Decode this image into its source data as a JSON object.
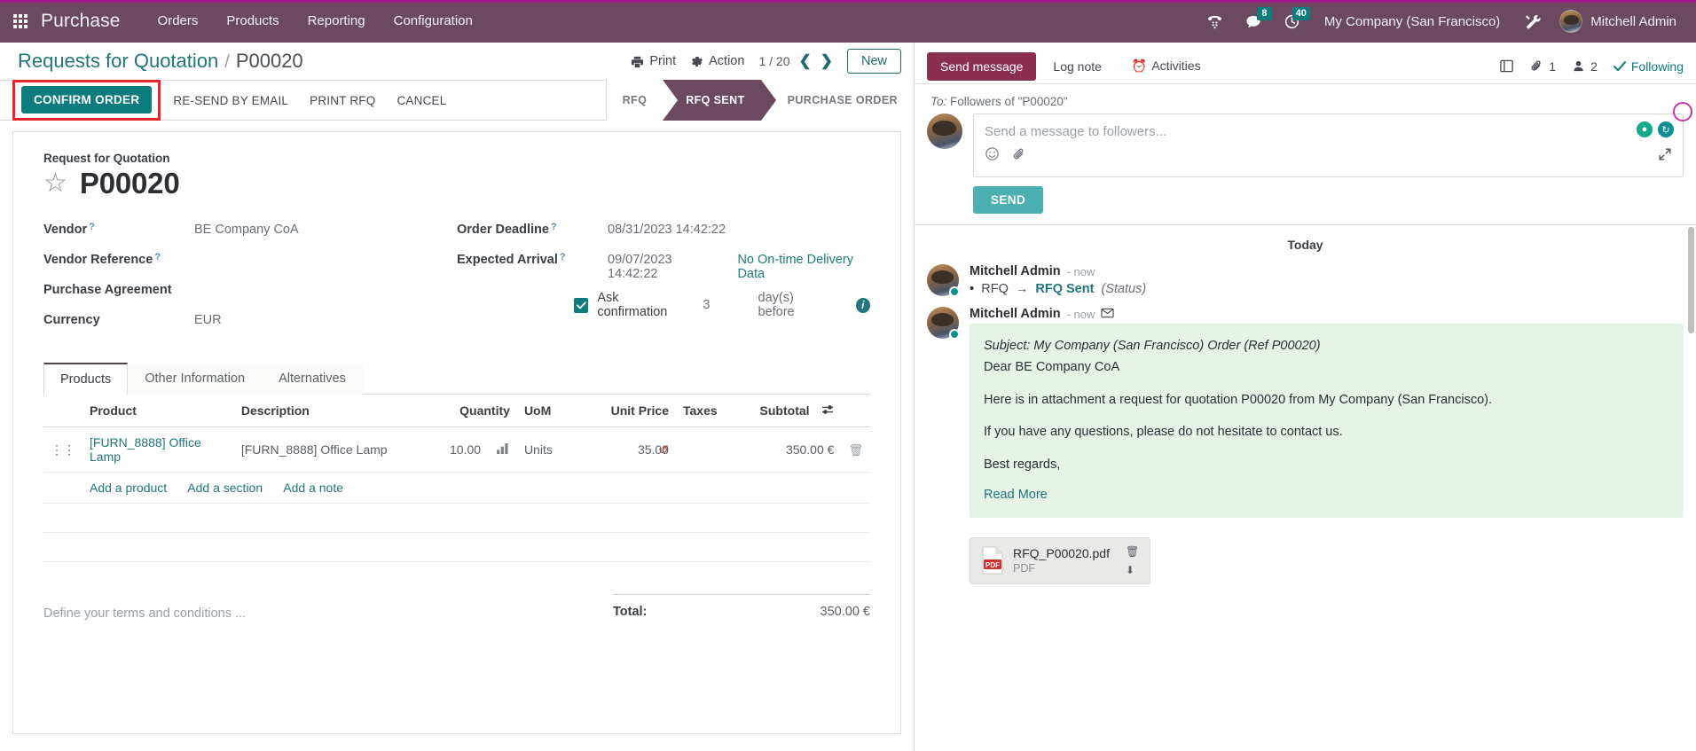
{
  "navbar": {
    "apps_icon": "apps-grid-icon",
    "brand": "Purchase",
    "menus": [
      "Orders",
      "Products",
      "Reporting",
      "Configuration"
    ],
    "icons": [
      {
        "name": "phone-keypad-icon",
        "badge": ""
      },
      {
        "name": "messages-icon",
        "badge": "8"
      },
      {
        "name": "activities-clock-icon",
        "badge": "40"
      }
    ],
    "company": "My Company (San Francisco)",
    "debug_icon": "tools-wrench-icon",
    "user": "Mitchell Admin",
    "accent": "#6b4a5f",
    "accent_top": "#a0198f",
    "badge_color": "#0d7c7c"
  },
  "control_panel": {
    "breadcrumb_root": "Requests for Quotation",
    "breadcrumb_sep": "/",
    "breadcrumb_current": "P00020",
    "print_label": "Print",
    "print_icon": "printer-icon",
    "action_label": "Action",
    "action_icon": "gear-icon",
    "pager": "1 / 20",
    "prev_icon": "chevron-left-icon",
    "next_icon": "chevron-right-icon",
    "new_label": "New"
  },
  "action_bar": {
    "confirm_label": "CONFIRM ORDER",
    "buttons": [
      "RE-SEND BY EMAIL",
      "PRINT RFQ",
      "CANCEL"
    ],
    "highlight_color": "#e8232a",
    "primary_color": "#0d7c7c",
    "statuses": [
      {
        "label": "RFQ",
        "active": false
      },
      {
        "label": "RFQ SENT",
        "active": true
      },
      {
        "label": "PURCHASE ORDER",
        "active": false
      }
    ]
  },
  "form": {
    "subtitle": "Request for Quotation",
    "star_icon": "star-outline-icon",
    "title": "P00020",
    "left_fields": [
      {
        "label": "Vendor",
        "help": true,
        "value": "BE Company CoA",
        "link": true
      },
      {
        "label": "Vendor Reference",
        "help": true,
        "value": ""
      },
      {
        "label": "Purchase Agreement",
        "help": false,
        "value": ""
      },
      {
        "label": "Currency",
        "help": false,
        "value": "EUR"
      }
    ],
    "right_fields": [
      {
        "label": "Order Deadline",
        "help": true,
        "value": "08/31/2023 14:42:22",
        "extra": ""
      },
      {
        "label": "Expected Arrival",
        "help": true,
        "value": "09/07/2023 14:42:22",
        "extra": "No On-time Delivery Data"
      }
    ],
    "ask_confirmation": {
      "checked": true,
      "label": "Ask confirmation",
      "days": "3",
      "suffix": "day(s) before",
      "info_icon": "info-circle-icon"
    }
  },
  "tabs": [
    {
      "label": "Products",
      "active": true
    },
    {
      "label": "Other Information",
      "active": false
    },
    {
      "label": "Alternatives",
      "active": false
    }
  ],
  "lines_table": {
    "columns": [
      "Product",
      "Description",
      "Quantity",
      "UoM",
      "Unit Price",
      "Taxes",
      "Subtotal"
    ],
    "settings_icon": "column-settings-icon",
    "rows": [
      {
        "drag_icon": "drag-handle-icon",
        "product": "[FURN_8888] Office Lamp",
        "description": "[FURN_8888] Office Lamp",
        "quantity": "10.00",
        "qty_icon": "forecast-chart-icon",
        "uom": "Units",
        "unit_price": "35.00",
        "price_icon": "reset-history-icon",
        "taxes": "",
        "subtotal": "350.00 €",
        "delete_icon": "trash-icon"
      }
    ],
    "add_links": [
      "Add a product",
      "Add a section",
      "Add a note"
    ]
  },
  "totals": {
    "terms_placeholder": "Define your terms and conditions ...",
    "total_label": "Total:",
    "total_value": "350.00 €"
  },
  "chatter": {
    "send_message_label": "Send message",
    "log_note_label": "Log note",
    "activities_label": "Activities",
    "activities_icon": "clock-icon",
    "attachments_panel_icon": "attachments-panel-icon",
    "attachment_count": "1",
    "attachment_icon": "paperclip-icon",
    "followers_count": "2",
    "followers_icon": "user-icon",
    "following_label": "Following",
    "following_icon": "check-icon",
    "to_prefix": "To:",
    "to_value": "Followers of \"P00020\"",
    "composer_placeholder": "Send a message to followers...",
    "emoji_icon": "emoji-icon",
    "attach_icon": "paperclip-icon",
    "expand_icon": "expand-icon",
    "badge_icons": [
      "location-pin-icon",
      "refresh-icon"
    ],
    "send_label": "SEND",
    "day_separator": "Today",
    "messages": [
      {
        "author": "Mitchell Admin",
        "time": "- now",
        "type": "tracking",
        "bullet": "•",
        "old_value": "RFQ",
        "arrow": "→",
        "new_value": "RFQ Sent",
        "field": "(Status)"
      },
      {
        "author": "Mitchell Admin",
        "time": "- now",
        "type": "email",
        "mail_icon": "envelope-icon",
        "subject": "Subject: My Company (San Francisco) Order (Ref P00020)",
        "greeting": "Dear BE Company CoA",
        "paragraphs": [
          "Here is in attachment a request for quotation P00020 from My Company (San Francisco).",
          "If you have any questions, please do not hesitate to contact us.",
          "Best regards,"
        ],
        "bold_ref": "P00020",
        "read_more": "Read More",
        "attachment": {
          "name": "RFQ_P00020.pdf",
          "type": "PDF",
          "file_icon": "pdf-file-icon",
          "delete_icon": "trash-icon",
          "download_icon": "download-icon"
        }
      }
    ]
  }
}
